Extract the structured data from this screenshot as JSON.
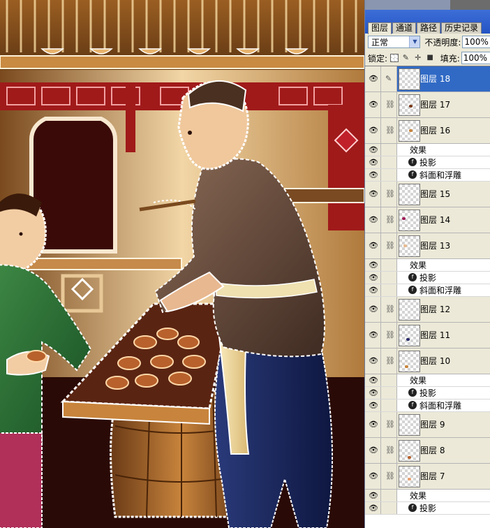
{
  "panel": {
    "tabs": [
      {
        "label": "图层",
        "active": true
      },
      {
        "label": "通道",
        "active": false
      },
      {
        "label": "路径",
        "active": false
      },
      {
        "label": "历史记录",
        "active": false
      }
    ],
    "blend_mode": "正常",
    "opacity_label": "不透明度:",
    "opacity_value": "100%",
    "lock_label": "锁定:",
    "fill_label": "填充:",
    "fill_value": "100%",
    "lock_icons": [
      "lock-transparent-icon",
      "lock-brush-icon",
      "lock-move-icon",
      "lock-all-icon"
    ],
    "rows": [
      {
        "kind": "layer",
        "name": "图层 18",
        "selected": true,
        "link": "brush"
      },
      {
        "kind": "layer",
        "name": "图层 17",
        "selected": false,
        "link": "chain"
      },
      {
        "kind": "layer",
        "name": "图层 16",
        "selected": false,
        "link": "chain"
      },
      {
        "kind": "effects",
        "name": "效果"
      },
      {
        "kind": "effect",
        "name": "投影"
      },
      {
        "kind": "effect",
        "name": "斜面和浮雕"
      },
      {
        "kind": "layer",
        "name": "图层 15",
        "selected": false,
        "link": "chain"
      },
      {
        "kind": "layer",
        "name": "图层 14",
        "selected": false,
        "link": "chain"
      },
      {
        "kind": "layer",
        "name": "图层 13",
        "selected": false,
        "link": "chain"
      },
      {
        "kind": "effects",
        "name": "效果"
      },
      {
        "kind": "effect",
        "name": "投影"
      },
      {
        "kind": "effect",
        "name": "斜面和浮雕"
      },
      {
        "kind": "layer",
        "name": "图层 12",
        "selected": false,
        "link": "chain"
      },
      {
        "kind": "layer",
        "name": "图层 11",
        "selected": false,
        "link": "chain"
      },
      {
        "kind": "layer",
        "name": "图层 10",
        "selected": false,
        "link": "chain"
      },
      {
        "kind": "effects",
        "name": "效果"
      },
      {
        "kind": "effect",
        "name": "投影"
      },
      {
        "kind": "effect",
        "name": "斜面和浮雕"
      },
      {
        "kind": "layer",
        "name": "图层 9",
        "selected": false,
        "link": "chain"
      },
      {
        "kind": "layer",
        "name": "图层 8",
        "selected": false,
        "link": "chain"
      },
      {
        "kind": "layer",
        "name": "图层 7",
        "selected": false,
        "link": "chain"
      },
      {
        "kind": "effects",
        "name": "效果"
      },
      {
        "kind": "effect",
        "name": "投影"
      }
    ]
  },
  "colors": {
    "selection": "#316ac5",
    "panel_bg": "#ece9d8",
    "title_blue": "#2454c4"
  }
}
